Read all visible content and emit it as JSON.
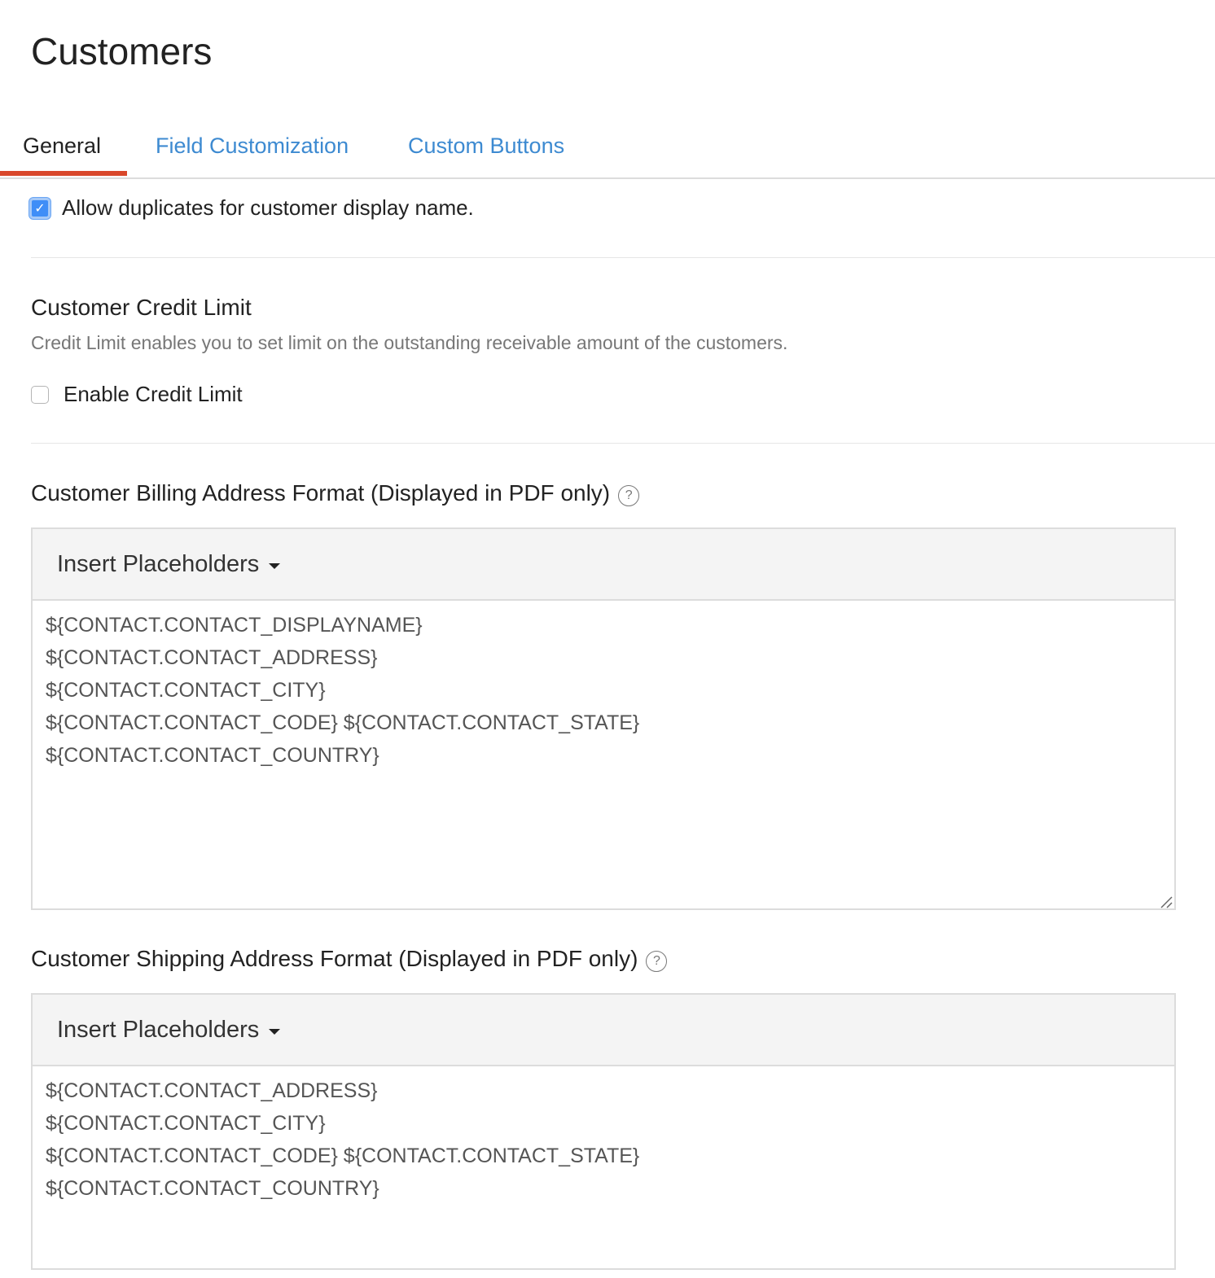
{
  "page": {
    "title": "Customers"
  },
  "tabs": [
    {
      "label": "General",
      "active": true
    },
    {
      "label": "Field Customization",
      "active": false
    },
    {
      "label": "Custom Buttons",
      "active": false
    }
  ],
  "duplicates": {
    "label": "Allow duplicates for customer display name.",
    "checked": true
  },
  "credit_limit": {
    "heading": "Customer Credit Limit",
    "description": "Credit Limit enables you to set limit on the outstanding receivable amount of the customers.",
    "checkbox_label": "Enable Credit Limit",
    "checked": false
  },
  "billing": {
    "heading": "Customer Billing Address Format (Displayed in PDF only)",
    "insert_label": "Insert Placeholders",
    "lines": [
      "${CONTACT.CONTACT_DISPLAYNAME}",
      "${CONTACT.CONTACT_ADDRESS}",
      "${CONTACT.CONTACT_CITY}",
      "${CONTACT.CONTACT_CODE} ${CONTACT.CONTACT_STATE}",
      "${CONTACT.CONTACT_COUNTRY}"
    ]
  },
  "shipping": {
    "heading": "Customer Shipping Address Format (Displayed in PDF only)",
    "insert_label": "Insert Placeholders",
    "lines": [
      "${CONTACT.CONTACT_ADDRESS}",
      "${CONTACT.CONTACT_CITY}",
      "${CONTACT.CONTACT_CODE} ${CONTACT.CONTACT_STATE}",
      "${CONTACT.CONTACT_COUNTRY}"
    ]
  },
  "icons": {
    "help": "?",
    "check": "✓"
  }
}
